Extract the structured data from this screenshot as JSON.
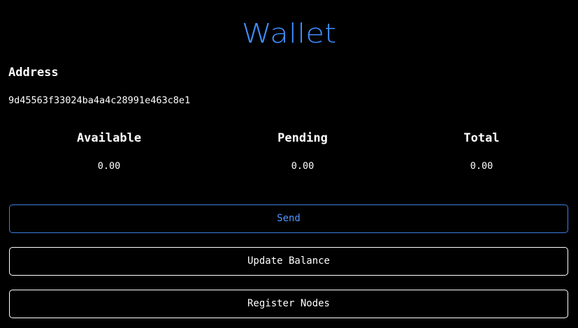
{
  "header": {
    "title": "Wallet"
  },
  "address": {
    "label": "Address",
    "value": "9d45563f33024ba4a4c28991e463c8e1"
  },
  "balances": {
    "available": {
      "label": "Available",
      "value": "0.00"
    },
    "pending": {
      "label": "Pending",
      "value": "0.00"
    },
    "total": {
      "label": "Total",
      "value": "0.00"
    }
  },
  "actions": {
    "send_label": "Send",
    "update_balance_label": "Update Balance",
    "register_nodes_label": "Register Nodes"
  },
  "colors": {
    "background": "#000000",
    "accent": "#3f8fff",
    "text": "#ffffff"
  }
}
